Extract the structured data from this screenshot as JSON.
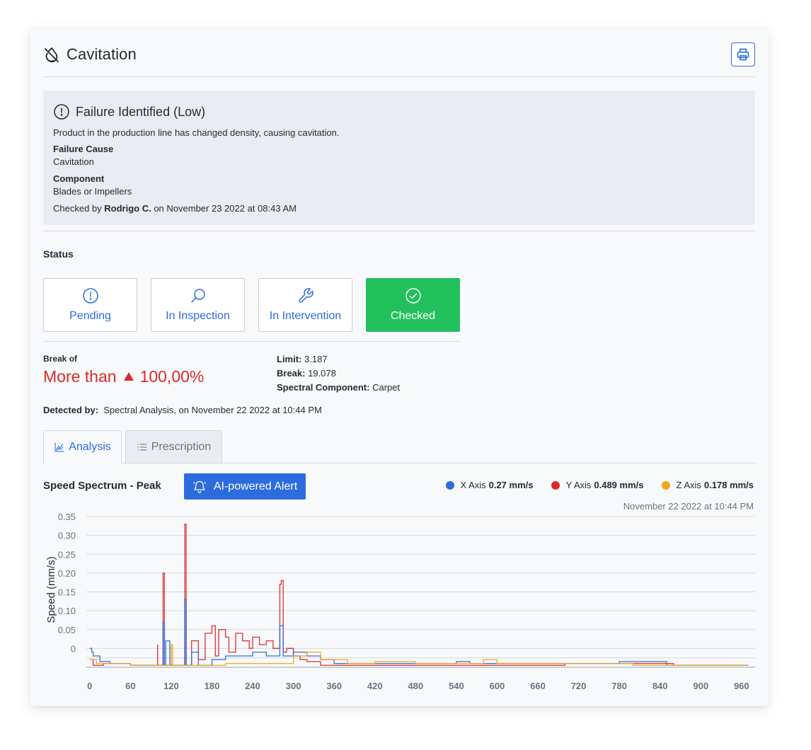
{
  "header": {
    "title": "Cavitation",
    "title_icon": "drop-off-icon",
    "print_icon": "printer-icon"
  },
  "failure": {
    "heading": "Failure Identified (Low)",
    "description": "Product in the production line has changed density, causing cavitation.",
    "cause_label": "Failure Cause",
    "cause_value": "Cavitation",
    "component_label": "Component",
    "component_value": "Blades or Impellers",
    "checked_prefix": "Checked by ",
    "checked_user": "Rodrigo C.",
    "checked_suffix": " on November 23 2022 at 08:43 AM"
  },
  "status": {
    "label": "Status",
    "buttons": [
      {
        "label": "Pending",
        "icon": "alert-circle-icon",
        "active": false
      },
      {
        "label": "In Inspection",
        "icon": "search-icon",
        "active": false
      },
      {
        "label": "In Intervention",
        "icon": "wrench-icon",
        "active": false
      },
      {
        "label": "Checked",
        "icon": "check-circle-icon",
        "active": true
      }
    ]
  },
  "break": {
    "label": "Break of",
    "prefix": "More than",
    "value": "100,00%",
    "limit_label": "Limit:",
    "limit_value": "3.187",
    "break_label": "Break:",
    "break_value": "19.078",
    "spectral_label": "Spectral Component:",
    "spectral_value": "Carpet"
  },
  "detected": {
    "label": "Detected by:",
    "value": "Spectral Analysis, on November 22 2022 at 10:44 PM"
  },
  "tabs": [
    {
      "label": "Analysis",
      "icon": "chart-line-icon",
      "active": true
    },
    {
      "label": "Prescription",
      "icon": "list-icon",
      "active": false
    }
  ],
  "chart_header": {
    "title": "Speed Spectrum - Peak",
    "ai_button": "AI-powered Alert",
    "timestamp": "November 22 2022 at 10:44 PM",
    "legend": [
      {
        "label": "X Axis",
        "value": "0.27 mm/s",
        "color": "#2d6cdf"
      },
      {
        "label": "Y Axis",
        "value": "0.489 mm/s",
        "color": "#d92b2b"
      },
      {
        "label": "Z Axis",
        "value": "0.178 mm/s",
        "color": "#f2a51c"
      }
    ]
  },
  "chart_data": {
    "type": "line",
    "title": "Speed Spectrum - Peak",
    "ylabel": "Speed (mm/s)",
    "xlabel": "",
    "ylim": [
      -0.05,
      0.35
    ],
    "xlim": [
      -5,
      980
    ],
    "x_ticks": [
      0,
      60,
      120,
      180,
      240,
      300,
      360,
      420,
      480,
      540,
      600,
      660,
      720,
      780,
      840,
      900,
      960
    ],
    "y_ticks": [
      0,
      0.05,
      0.1,
      0.15,
      0.2,
      0.25,
      0.3,
      0.35
    ],
    "y_tick_labels": [
      "0",
      "0.05",
      "0.10",
      "0.15",
      "0.20",
      "0.25",
      "0.30",
      "0.35"
    ],
    "grid": true,
    "series": [
      {
        "name": "Y Axis",
        "color": "#d92b2b",
        "points": [
          [
            0,
            -0.03
          ],
          [
            5,
            -0.045
          ],
          [
            20,
            -0.04
          ],
          [
            60,
            -0.045
          ],
          [
            90,
            -0.045
          ],
          [
            100,
            0.01
          ],
          [
            100,
            -0.045
          ],
          [
            108,
            0.2
          ],
          [
            110,
            -0.045
          ],
          [
            140,
            0.33
          ],
          [
            142,
            -0.045
          ],
          [
            150,
            0.02
          ],
          [
            160,
            -0.03
          ],
          [
            170,
            0.04
          ],
          [
            180,
            0.06
          ],
          [
            185,
            -0.02
          ],
          [
            190,
            0.05
          ],
          [
            200,
            0.03
          ],
          [
            205,
            -0.01
          ],
          [
            215,
            0.04
          ],
          [
            225,
            0.02
          ],
          [
            235,
            0.0
          ],
          [
            240,
            0.03
          ],
          [
            250,
            0.01
          ],
          [
            260,
            0.02
          ],
          [
            270,
            0.0
          ],
          [
            280,
            0.17
          ],
          [
            282,
            0.18
          ],
          [
            285,
            -0.01
          ],
          [
            290,
            0.0
          ],
          [
            300,
            -0.02
          ],
          [
            310,
            -0.03
          ],
          [
            320,
            -0.035
          ],
          [
            340,
            -0.045
          ],
          [
            360,
            -0.045
          ],
          [
            420,
            -0.045
          ],
          [
            600,
            -0.045
          ],
          [
            700,
            -0.04
          ],
          [
            800,
            -0.04
          ],
          [
            860,
            -0.045
          ],
          [
            960,
            -0.045
          ],
          [
            970,
            -0.045
          ]
        ]
      },
      {
        "name": "X Axis",
        "color": "#2d6cdf",
        "points": [
          [
            0,
            0.0
          ],
          [
            3,
            -0.01
          ],
          [
            5,
            -0.02
          ],
          [
            15,
            -0.035
          ],
          [
            30,
            -0.04
          ],
          [
            60,
            -0.045
          ],
          [
            100,
            -0.045
          ],
          [
            108,
            0.07
          ],
          [
            110,
            -0.045
          ],
          [
            112,
            0.02
          ],
          [
            118,
            -0.045
          ],
          [
            140,
            0.13
          ],
          [
            142,
            -0.045
          ],
          [
            150,
            -0.01
          ],
          [
            160,
            -0.045
          ],
          [
            180,
            -0.03
          ],
          [
            200,
            -0.02
          ],
          [
            240,
            -0.01
          ],
          [
            260,
            -0.02
          ],
          [
            280,
            0.06
          ],
          [
            285,
            -0.02
          ],
          [
            300,
            -0.01
          ],
          [
            320,
            -0.02
          ],
          [
            340,
            -0.03
          ],
          [
            360,
            -0.04
          ],
          [
            380,
            -0.04
          ],
          [
            420,
            -0.04
          ],
          [
            500,
            -0.04
          ],
          [
            540,
            -0.035
          ],
          [
            560,
            -0.04
          ],
          [
            600,
            -0.04
          ],
          [
            700,
            -0.04
          ],
          [
            760,
            -0.04
          ],
          [
            780,
            -0.035
          ],
          [
            820,
            -0.035
          ],
          [
            850,
            -0.045
          ],
          [
            900,
            -0.045
          ],
          [
            960,
            -0.045
          ],
          [
            970,
            -0.045
          ]
        ]
      },
      {
        "name": "Z Axis",
        "color": "#f2a51c",
        "points": [
          [
            0,
            -0.03
          ],
          [
            10,
            -0.04
          ],
          [
            60,
            -0.045
          ],
          [
            100,
            -0.045
          ],
          [
            120,
            0.01
          ],
          [
            122,
            -0.045
          ],
          [
            200,
            -0.04
          ],
          [
            300,
            -0.02
          ],
          [
            320,
            -0.01
          ],
          [
            340,
            -0.03
          ],
          [
            380,
            -0.04
          ],
          [
            420,
            -0.035
          ],
          [
            480,
            -0.04
          ],
          [
            540,
            -0.04
          ],
          [
            580,
            -0.03
          ],
          [
            600,
            -0.04
          ],
          [
            700,
            -0.04
          ],
          [
            760,
            -0.04
          ],
          [
            800,
            -0.045
          ],
          [
            960,
            -0.045
          ],
          [
            970,
            -0.045
          ]
        ]
      }
    ]
  }
}
